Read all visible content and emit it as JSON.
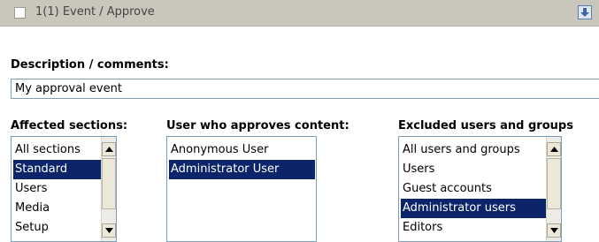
{
  "header": {
    "title": "1(1) Event / Approve",
    "collapse_icon": "arrow-down-icon"
  },
  "description": {
    "label": "Description / comments:",
    "value": "My approval event"
  },
  "sections": {
    "label": "Affected sections:",
    "options": [
      {
        "text": "All sections",
        "selected": false
      },
      {
        "text": "Standard",
        "selected": true
      },
      {
        "text": "Users",
        "selected": false
      },
      {
        "text": "Media",
        "selected": false
      },
      {
        "text": "Setup",
        "selected": false
      }
    ]
  },
  "approvers": {
    "label": "User who approves content:",
    "options": [
      {
        "text": "Anonymous User",
        "selected": false
      },
      {
        "text": "Administrator User",
        "selected": true
      }
    ]
  },
  "excluded": {
    "label": "Excluded users and groups",
    "options": [
      {
        "text": "All users and groups",
        "selected": false
      },
      {
        "text": "Users",
        "selected": false
      },
      {
        "text": "Guest accounts",
        "selected": false
      },
      {
        "text": "Administrator users",
        "selected": true
      },
      {
        "text": "Editors",
        "selected": false
      }
    ]
  },
  "colors": {
    "header_bg": "#c9c6bc",
    "selection_bg": "#0b246a",
    "field_border": "#7f9db9"
  }
}
